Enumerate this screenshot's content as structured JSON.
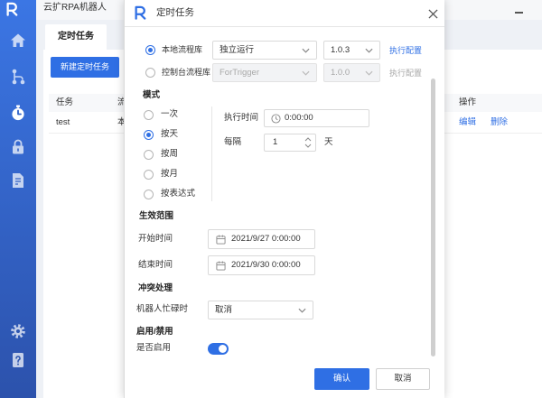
{
  "colors": {
    "accent": "#2f6fe4",
    "sidebar_top": "#3b76e4",
    "sidebar_bottom": "#2c52ac",
    "text": "#333333",
    "muted": "#a8a8a8",
    "header_bg": "#f7f8fa"
  },
  "app": {
    "title": "云扩RPA机器人",
    "logo_icon": "r-logo-icon",
    "minimize_icon": "minimize-icon"
  },
  "sidebar": {
    "items": [
      {
        "id": "home",
        "icon": "home-icon",
        "active": false
      },
      {
        "id": "flow",
        "icon": "flow-tree-icon",
        "active": false
      },
      {
        "id": "schedule",
        "icon": "stopwatch-icon",
        "active": true
      },
      {
        "id": "lock",
        "icon": "lock-icon",
        "active": false
      },
      {
        "id": "log",
        "icon": "document-icon",
        "active": false
      }
    ],
    "bottom_items": [
      {
        "id": "settings",
        "icon": "gear-icon"
      },
      {
        "id": "help",
        "icon": "help-document-icon"
      }
    ]
  },
  "tabs": [
    {
      "label": "定时任务",
      "active": true
    }
  ],
  "toolbar": {
    "new_task_label": "新建定时任务"
  },
  "table": {
    "columns": {
      "task": "任务",
      "flow": "流",
      "actions": "操作"
    },
    "rows": [
      {
        "task": "test",
        "flow": "本",
        "edit": "编辑",
        "delete": "删除"
      }
    ]
  },
  "dialog": {
    "title": "定时任务",
    "logo_icon": "r-logo-icon",
    "close_icon": "close-icon",
    "source": {
      "options": [
        {
          "label": "本地流程库",
          "checked": true,
          "mode": "独立运行",
          "version": "1.0.3",
          "config_link": "执行配置",
          "disabled": false
        },
        {
          "label": "控制台流程库",
          "checked": false,
          "mode": "ForTrigger",
          "version": "1.0.0",
          "config_link": "执行配置",
          "disabled": true
        }
      ]
    },
    "mode": {
      "heading": "模式",
      "options": [
        {
          "label": "一次",
          "checked": false
        },
        {
          "label": "按天",
          "checked": true
        },
        {
          "label": "按周",
          "checked": false
        },
        {
          "label": "按月",
          "checked": false
        },
        {
          "label": "按表达式",
          "checked": false
        }
      ],
      "exec_time_label": "执行时间",
      "exec_time_value": "0:00:00",
      "interval_label": "每隔",
      "interval_value": "1",
      "interval_unit": "天"
    },
    "range": {
      "heading": "生效范围",
      "start_label": "开始时间",
      "start_value": "2021/9/27 0:00:00",
      "end_label": "结束时间",
      "end_value": "2021/9/30 0:00:00"
    },
    "conflict": {
      "heading": "冲突处理",
      "busy_label": "机器人忙碌时",
      "busy_value": "取消"
    },
    "enable": {
      "heading": "启用/禁用",
      "label": "是否启用",
      "enabled": true
    },
    "footer": {
      "confirm": "确认",
      "cancel": "取消"
    }
  }
}
